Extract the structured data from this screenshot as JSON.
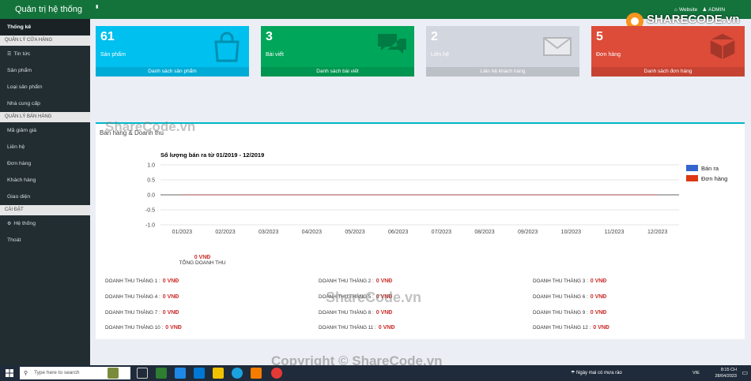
{
  "header": {
    "brand": "Quản trị hệ thống",
    "website": "Website",
    "admin": "ADMIN"
  },
  "logo_text": "SHARECODE.vn",
  "sidebar": {
    "top": "Thống kê",
    "sections": [
      {
        "header": "QUẢN LÝ CỬA HÀNG",
        "items": [
          "Tin tức",
          "Sản phẩm",
          "Loại sản phẩm",
          "Nhà cung cấp"
        ]
      },
      {
        "header": "QUẢN LÝ BÁN HÀNG",
        "items": [
          "Mã giảm giá",
          "Liên hệ",
          "Đơn hàng",
          "Khách hàng",
          "Giao diện"
        ]
      },
      {
        "header": "CÀI ĐẶT",
        "items": [
          "Hệ thống",
          "Thoát"
        ]
      }
    ]
  },
  "boxes": [
    {
      "num": "61",
      "label": "Sản phẩm",
      "footer": "Danh sách sản phẩm",
      "color": "#00c0ef"
    },
    {
      "num": "3",
      "label": "Bài viết",
      "footer": "Danh sách bài viết",
      "color": "#00a65a"
    },
    {
      "num": "2",
      "label": "Liên hệ",
      "footer": "Liên hệ khách hàng",
      "color": "#d2d6de"
    },
    {
      "num": "5",
      "label": "Đơn hàng",
      "footer": "Danh sách đơn hàng",
      "color": "#dd4b39"
    }
  ],
  "panel": {
    "title": "Bán hàng & Doanh thu"
  },
  "chart_data": {
    "type": "line",
    "title": "Số lượng bán ra từ 01/2019 - 12/2019",
    "categories": [
      "01/2023",
      "02/2023",
      "03/2023",
      "04/2023",
      "05/2023",
      "06/2023",
      "07/2023",
      "08/2023",
      "09/2023",
      "10/2023",
      "11/2023",
      "12/2023"
    ],
    "series": [
      {
        "name": "Bán ra",
        "color": "#3366cc",
        "values": [
          0,
          0,
          0,
          0,
          0,
          0,
          0,
          0,
          0,
          0,
          0,
          0
        ]
      },
      {
        "name": "Đơn hàng",
        "color": "#dc3912",
        "values": [
          0,
          0,
          0,
          0,
          0,
          0,
          0,
          0,
          0,
          0,
          0,
          0
        ]
      }
    ],
    "yticks": [
      "1.0",
      "0.5",
      "0.0",
      "-0.5",
      "-1.0"
    ],
    "ylim": [
      -1,
      1
    ],
    "legend": "right"
  },
  "revenue": {
    "total": "0 VNĐ",
    "total_label": "TỔNG DOANH THU",
    "months": [
      {
        "label": "DOANH THU THÁNG 1 :",
        "value": "0 VNĐ"
      },
      {
        "label": "DOANH THU THÁNG 2 :",
        "value": "0 VNĐ"
      },
      {
        "label": "DOANH THU THÁNG 3 :",
        "value": "0 VNĐ"
      },
      {
        "label": "DOANH THU THÁNG 4 :",
        "value": "0 VNĐ"
      },
      {
        "label": "DOANH THU THÁNG 5 :",
        "value": "0 VNĐ"
      },
      {
        "label": "DOANH THU THÁNG 6 :",
        "value": "0 VNĐ"
      },
      {
        "label": "DOANH THU THÁNG 7 :",
        "value": "0 VNĐ"
      },
      {
        "label": "DOANH THU THÁNG 8 :",
        "value": "0 VNĐ"
      },
      {
        "label": "DOANH THU THÁNG 9 :",
        "value": "0 VNĐ"
      },
      {
        "label": "DOANH THU THÁNG 10 :",
        "value": "0 VNĐ"
      },
      {
        "label": "DOANH THU THÁNG 11 :",
        "value": "0 VNĐ"
      },
      {
        "label": "DOANH THU THÁNG 12 :",
        "value": "0 VNĐ"
      }
    ]
  },
  "watermarks": [
    "ShareCode.vn",
    "ShareCode.vn",
    "Copyright © ShareCode.vn"
  ],
  "taskbar": {
    "search_placeholder": "Type here to search",
    "weather": "Ngày mai có mưa rào",
    "lang": "VIE",
    "time": "8:15 CH",
    "date": "28/04/2023"
  }
}
